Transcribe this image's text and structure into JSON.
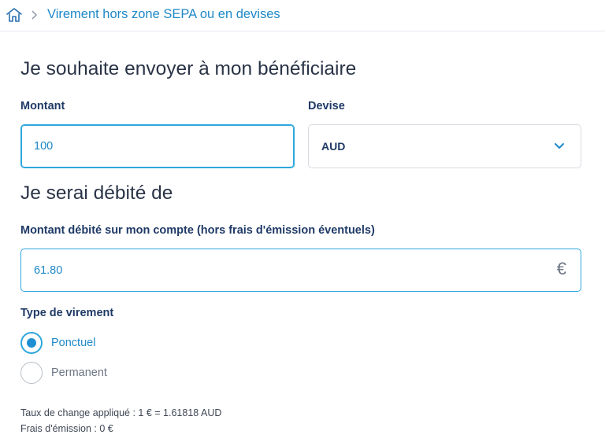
{
  "breadcrumb": {
    "current": "Virement hors zone SEPA ou en devises"
  },
  "section_send": {
    "title": "Je souhaite envoyer à mon bénéficiaire"
  },
  "amount": {
    "label": "Montant",
    "value": "100"
  },
  "currency": {
    "label": "Devise",
    "selected": "AUD"
  },
  "section_debit": {
    "title": "Je serai débité de"
  },
  "debit_amount": {
    "label": "Montant débité sur mon compte (hors frais d'émission éventuels)",
    "value": "61.80",
    "currency_symbol": "€"
  },
  "transfer_type": {
    "label": "Type de virement",
    "options": [
      {
        "label": "Ponctuel",
        "selected": true
      },
      {
        "label": "Permanent",
        "selected": false
      }
    ]
  },
  "info": {
    "exchange_rate": "Taux de change appliqué : 1 € = 1.61818 AUD",
    "fees": "Frais d'émission : 0 €"
  },
  "colors": {
    "accent": "#1e88c8",
    "focus_border": "#2ea7dc",
    "label": "#1f3a66"
  }
}
